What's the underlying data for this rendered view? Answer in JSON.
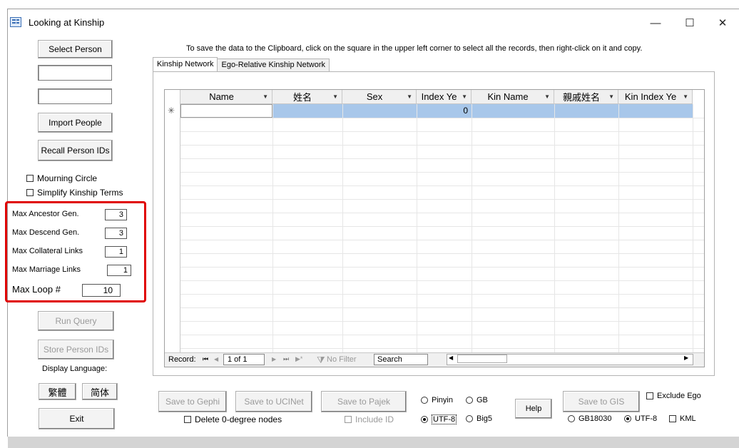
{
  "window": {
    "title": "Looking at Kinship",
    "minimize_glyph": "—",
    "maximize_glyph": "☐",
    "close_glyph": "✕"
  },
  "left_panel": {
    "select_person": "Select Person",
    "import_people": "Import People",
    "recall_person_ids": "Recall Person IDs",
    "mourning_circle": "Mourning Circle",
    "simplify_kinship": "Simplify Kinship Terms",
    "max_ancestor_label": "Max Ancestor Gen.",
    "max_ancestor_value": "3",
    "max_descend_label": "Max Descend Gen.",
    "max_descend_value": "3",
    "max_collateral_label": "Max Collateral Links",
    "max_collateral_value": "1",
    "max_marriage_label": "Max Marriage Links",
    "max_marriage_value": "1",
    "max_loop_label": "Max Loop #",
    "max_loop_value": "10",
    "run_query": "Run Query",
    "store_person_ids": "Store Person IDs",
    "display_language": "Display Language:",
    "traditional": "繁體",
    "simplified": "简体",
    "exit": "Exit"
  },
  "notice": "To save the data to the Clipboard, click on the square in the upper left corner to select all the records, then right-click on it and copy.",
  "tabs": [
    "Kinship Network",
    "Ego-Relative Kinship Network"
  ],
  "grid": {
    "columns": [
      "Name",
      "姓名",
      "Sex",
      "Index Ye",
      "Kin Name",
      "親戚姓名",
      "Kin Index Ye"
    ],
    "new_row_marker": "✳",
    "new_row_index_value": "0",
    "nav": {
      "record_label": "Record:",
      "first": "⏮",
      "prev": "◀",
      "position": "1 of 1",
      "next": "▶",
      "last": "⏭",
      "new": "▶*",
      "no_filter": "No Filter",
      "search": "Search"
    }
  },
  "bottom": {
    "save_gephi": "Save to Gephi",
    "save_ucinet": "Save to UCINet",
    "save_pajek": "Save to Pajek",
    "pinyin": "Pinyin",
    "gb": "GB",
    "utf8": "UTF-8",
    "big5": "Big5",
    "help": "Help",
    "save_gis": "Save to GIS",
    "exclude_ego": "Exclude Ego",
    "delete_zero": "Delete 0-degree nodes",
    "include_id": "Include ID",
    "gb18030": "GB18030",
    "utf8_gis": "UTF-8",
    "kml": "KML"
  }
}
